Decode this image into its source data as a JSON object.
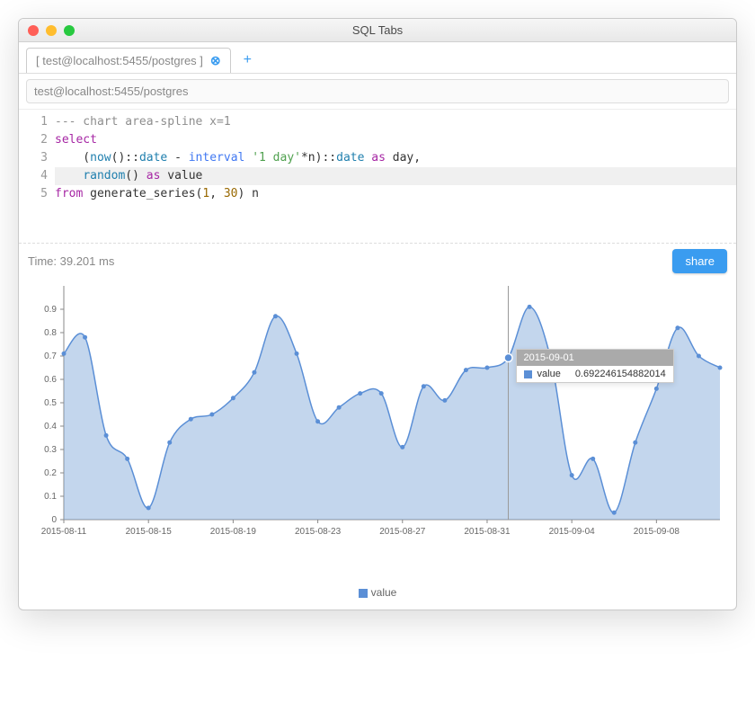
{
  "window": {
    "title": "SQL Tabs"
  },
  "tab": {
    "label": "[ test@localhost:5455/postgres ]"
  },
  "connection": {
    "value": "test@localhost:5455/postgres"
  },
  "editor": {
    "lines": [
      {
        "n": "1",
        "segs": [
          {
            "t": "--- chart area-spline x=1",
            "c": "c-comment"
          }
        ]
      },
      {
        "n": "2",
        "segs": [
          {
            "t": "select",
            "c": "c-kw"
          }
        ]
      },
      {
        "n": "3",
        "segs": [
          {
            "t": "    (",
            "c": ""
          },
          {
            "t": "now",
            "c": "c-func"
          },
          {
            "t": "()::",
            "c": ""
          },
          {
            "t": "date",
            "c": "c-type"
          },
          {
            "t": " - ",
            "c": ""
          },
          {
            "t": "interval",
            "c": "c-int"
          },
          {
            "t": " ",
            "c": ""
          },
          {
            "t": "'1 day'",
            "c": "c-str"
          },
          {
            "t": "*n)::",
            "c": ""
          },
          {
            "t": "date",
            "c": "c-type"
          },
          {
            "t": " ",
            "c": ""
          },
          {
            "t": "as",
            "c": "c-kw"
          },
          {
            "t": " day,",
            "c": ""
          }
        ]
      },
      {
        "n": "4",
        "hl": true,
        "segs": [
          {
            "t": "    ",
            "c": ""
          },
          {
            "t": "random",
            "c": "c-func"
          },
          {
            "t": "() ",
            "c": ""
          },
          {
            "t": "as",
            "c": "c-kw"
          },
          {
            "t": " value",
            "c": ""
          }
        ]
      },
      {
        "n": "5",
        "segs": [
          {
            "t": "from",
            "c": "c-kw"
          },
          {
            "t": " generate_series(",
            "c": ""
          },
          {
            "t": "1",
            "c": "c-num"
          },
          {
            "t": ", ",
            "c": ""
          },
          {
            "t": "30",
            "c": "c-num"
          },
          {
            "t": ") n",
            "c": ""
          }
        ]
      }
    ]
  },
  "result": {
    "timing_label": "Time: 39.201 ms",
    "share_label": "share"
  },
  "tooltip": {
    "title": "2015-09-01",
    "series_label": "value",
    "value": "0.692246154882014"
  },
  "legend": {
    "label": "value"
  },
  "chart_data": {
    "type": "area",
    "title": "",
    "xlabel": "",
    "ylabel": "",
    "ylim": [
      0,
      1
    ],
    "yticks": [
      0,
      0.1,
      0.2,
      0.3,
      0.4,
      0.5,
      0.6,
      0.7,
      0.8,
      0.9
    ],
    "xticks": [
      "2015-08-11",
      "2015-08-15",
      "2015-08-19",
      "2015-08-23",
      "2015-08-27",
      "2015-08-31",
      "2015-09-04",
      "2015-09-08"
    ],
    "series": [
      {
        "name": "value",
        "color": "#5b8fd6",
        "x": [
          "2015-08-11",
          "2015-08-12",
          "2015-08-13",
          "2015-08-14",
          "2015-08-15",
          "2015-08-16",
          "2015-08-17",
          "2015-08-18",
          "2015-08-19",
          "2015-08-20",
          "2015-08-21",
          "2015-08-22",
          "2015-08-23",
          "2015-08-24",
          "2015-08-25",
          "2015-08-26",
          "2015-08-27",
          "2015-08-28",
          "2015-08-29",
          "2015-08-30",
          "2015-08-31",
          "2015-09-01",
          "2015-09-02",
          "2015-09-03",
          "2015-09-04",
          "2015-09-05",
          "2015-09-06",
          "2015-09-07",
          "2015-09-08"
        ],
        "values": [
          0.71,
          0.78,
          0.36,
          0.26,
          0.05,
          0.33,
          0.43,
          0.45,
          0.52,
          0.63,
          0.87,
          0.71,
          0.42,
          0.48,
          0.54,
          0.54,
          0.31,
          0.57,
          0.51,
          0.64,
          0.65,
          0.692246154882014,
          0.91,
          0.69,
          0.19,
          0.26,
          0.03,
          0.33,
          0.56
        ]
      }
    ],
    "extra_tail_values": [
      0.82,
      0.7,
      0.65
    ],
    "highlight_x": "2015-09-01"
  }
}
